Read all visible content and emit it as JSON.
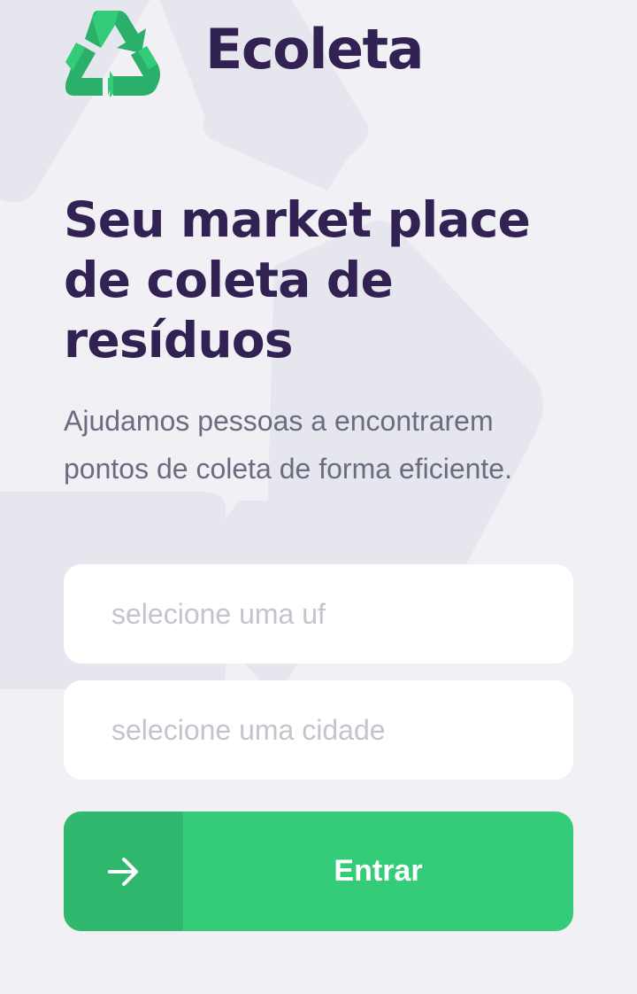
{
  "app": {
    "name": "Ecoleta",
    "logo_icon": "recycle-icon"
  },
  "hero": {
    "title_lines": [
      "Seu market place",
      "de coleta de",
      "resíduos"
    ],
    "description": "Ajudamos pessoas a encontrarem pontos de coleta de forma eficiente."
  },
  "form": {
    "uf_placeholder": "selecione uma uf",
    "city_placeholder": "selecione uma cidade",
    "submit_label": "Entrar",
    "submit_icon": "arrow-right-icon"
  },
  "colors": {
    "background": "#f0f0f5",
    "title": "#322153",
    "text": "#6c6c80",
    "placeholder": "#c4c4cc",
    "primary": "#34cb79",
    "primary_dark": "#2fb86e"
  }
}
